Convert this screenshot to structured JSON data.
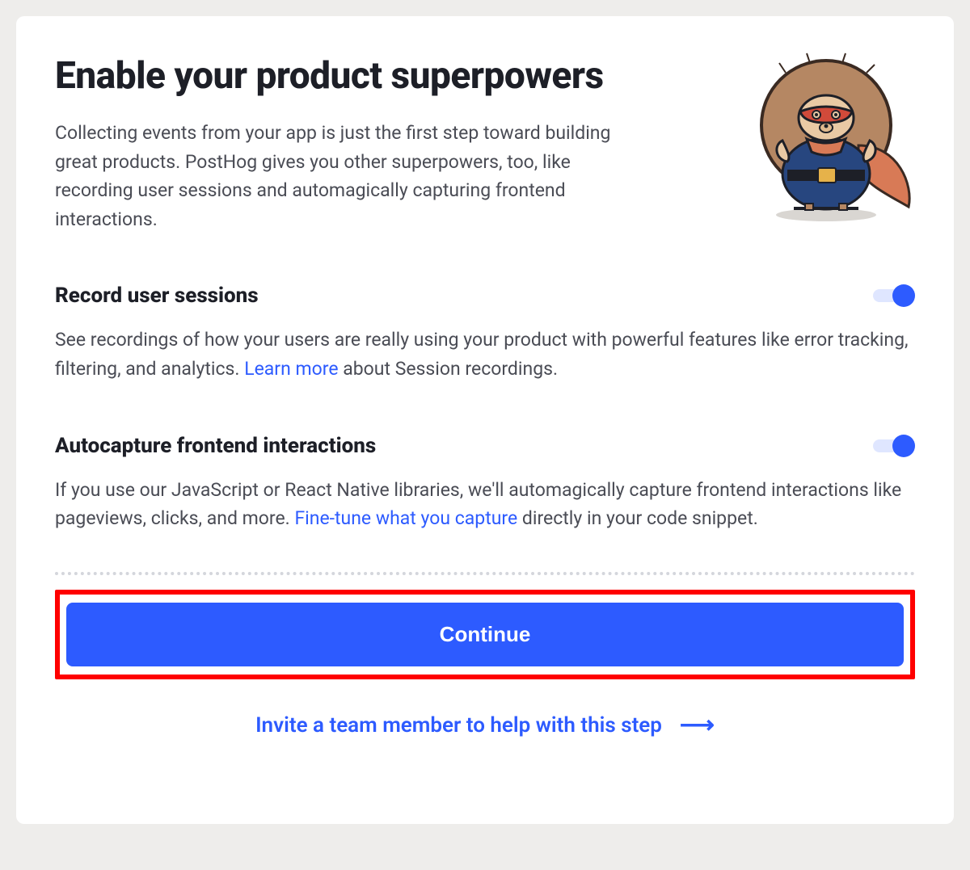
{
  "header": {
    "title": "Enable your product superpowers",
    "intro": "Collecting events from your app is just the first step toward building great products. PostHog gives you other superpowers, too, like recording user sessions and automagically capturing frontend interactions."
  },
  "sections": [
    {
      "title": "Record user sessions",
      "toggle_on": true,
      "desc_before": "See recordings of how your users are really using your product with powerful features like error tracking, filtering, and analytics. ",
      "link_text": "Learn more",
      "desc_after": " about Session recordings."
    },
    {
      "title": "Autocapture frontend interactions",
      "toggle_on": true,
      "desc_before": "If you use our JavaScript or React Native libraries, we'll automagically capture frontend interactions like pageviews, clicks, and more. ",
      "link_text": "Fine-tune what you capture",
      "desc_after": " directly in your code snippet."
    }
  ],
  "cta": {
    "label": "Continue"
  },
  "invite": {
    "label": "Invite a team member to help with this step"
  }
}
